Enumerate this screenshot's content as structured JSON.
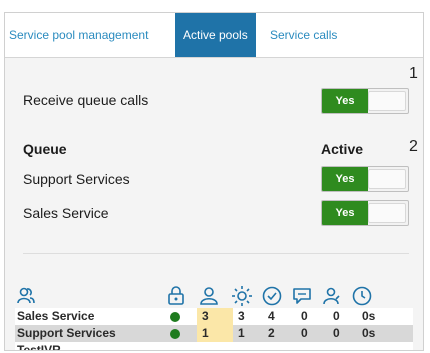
{
  "tabs": [
    {
      "label": "Service pool management",
      "active": false
    },
    {
      "label": "Active pools",
      "active": true
    },
    {
      "label": "Service calls",
      "active": false
    }
  ],
  "section_numbers": [
    "1",
    "2"
  ],
  "receive_queue": {
    "label": "Receive queue calls",
    "toggle": "Yes"
  },
  "queue_header": {
    "queue": "Queue",
    "active": "Active"
  },
  "queues": [
    {
      "name": "Support Services",
      "toggle": "Yes"
    },
    {
      "name": "Sales Service",
      "toggle": "Yes"
    }
  ],
  "stats_icons": [
    "agents-icon",
    "lock-icon",
    "user-icon",
    "sun-icon",
    "check-circle-icon",
    "chat-icon",
    "user-outline-icon",
    "clock-icon"
  ],
  "stats_rows": [
    {
      "name": "Sales Service",
      "values": [
        "3",
        "3",
        "4",
        "0",
        "0",
        "0s"
      ]
    },
    {
      "name": "Support Services",
      "values": [
        "1",
        "1",
        "2",
        "0",
        "0",
        "0s"
      ]
    },
    {
      "name": "TestIVR",
      "values": []
    }
  ],
  "colors": {
    "accent": "#1f73a8",
    "toggle_on": "#2f8b1f",
    "status_green": "#1e7b1e",
    "highlight": "#fbe7a8"
  }
}
